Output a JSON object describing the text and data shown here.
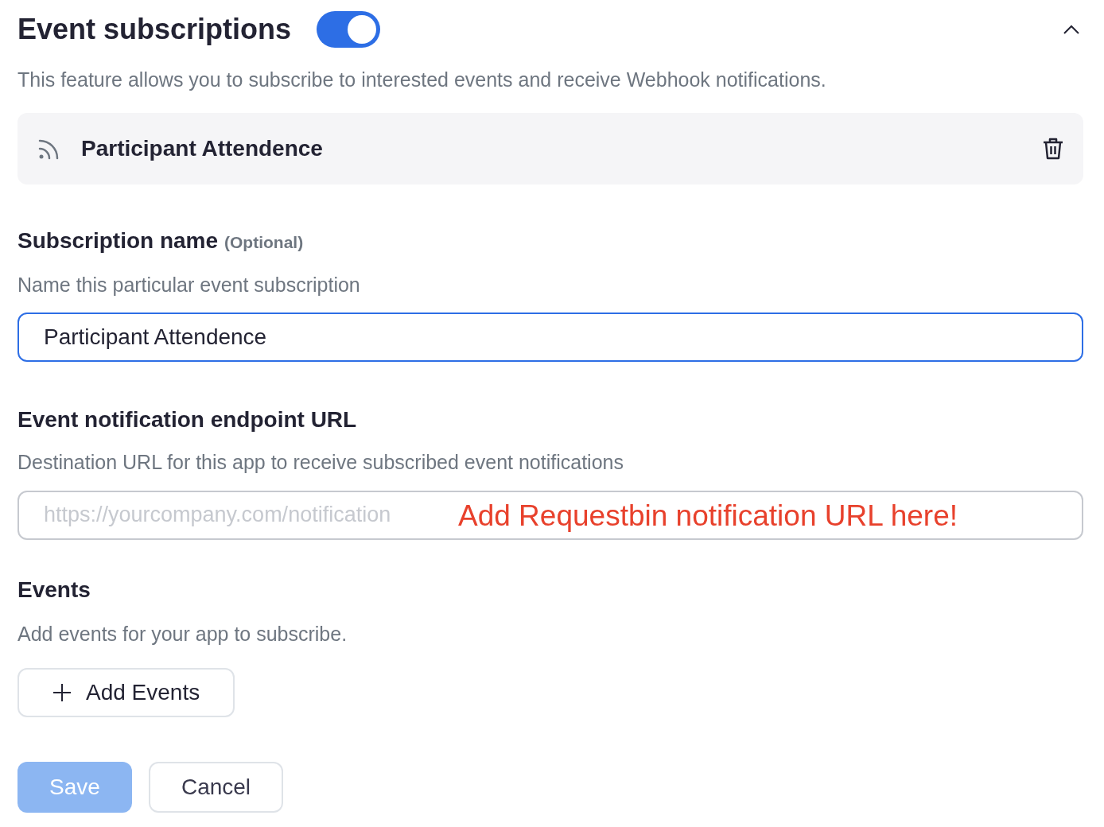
{
  "header": {
    "title": "Event subscriptions",
    "enabled": true,
    "description": "This feature allows you to subscribe to interested events and receive Webhook notifications."
  },
  "subscription_card": {
    "title": "Participant Attendence"
  },
  "subscription_name": {
    "label": "Subscription name",
    "optional": "(Optional)",
    "help": "Name this particular event subscription",
    "value": "Participant Attendence",
    "focused": true
  },
  "endpoint_url": {
    "label": "Event notification endpoint URL",
    "help": "Destination URL for this app to receive subscribed event notifications",
    "placeholder": "https://yourcompany.com/notification",
    "annotation": "Add Requestbin notification URL here!",
    "focused": false
  },
  "events": {
    "label": "Events",
    "help": "Add events for your app to subscribe.",
    "button": "Add Events"
  },
  "buttons": [
    {
      "label": "Save",
      "kind": "primary",
      "disabled": true
    },
    {
      "label": "Cancel",
      "kind": "secondary",
      "disabled": false
    }
  ]
}
